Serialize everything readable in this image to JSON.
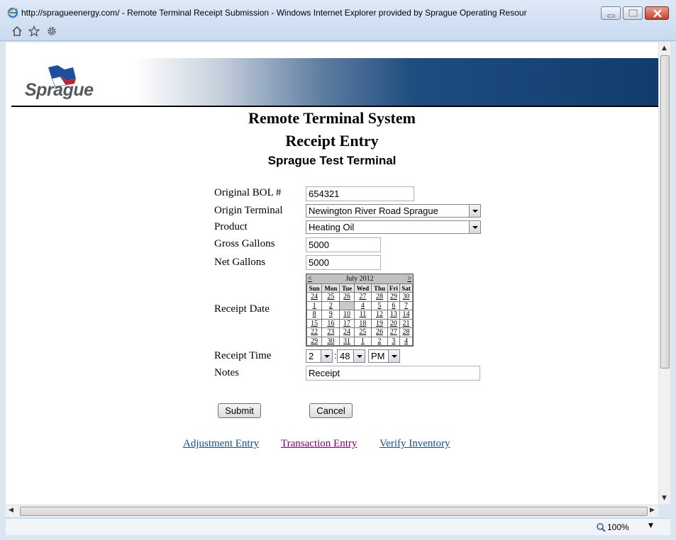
{
  "window": {
    "title": "http://spragueenergy.com/ - Remote Terminal Receipt Submission - Windows Internet Explorer provided by Sprague Operating Resour",
    "zoom": "100%"
  },
  "brand": {
    "logo_text": "Sprague",
    "banner_color": "#113c6e"
  },
  "header": {
    "title": "Remote Terminal System",
    "subtitle": "Receipt Entry",
    "terminal": "Sprague Test Terminal"
  },
  "form": {
    "bol_label": "Original BOL #",
    "bol_value": "654321",
    "origin_label": "Origin Terminal",
    "origin_value": "Newington River Road Sprague",
    "product_label": "Product",
    "product_value": "Heating Oil",
    "gross_label": "Gross Gallons",
    "gross_value": "5000",
    "net_label": "Net Gallons",
    "net_value": "5000",
    "date_label": "Receipt Date",
    "time_label": "Receipt Time",
    "time_hour": "2",
    "time_sep": ":",
    "time_minute": "48",
    "time_ampm": "PM",
    "notes_label": "Notes",
    "notes_value": "Receipt"
  },
  "calendar": {
    "month": "July 2012",
    "prev": "<",
    "next": ">",
    "days": [
      "Sun",
      "Mon",
      "Tue",
      "Wed",
      "Thu",
      "Fri",
      "Sat"
    ],
    "weeks": [
      [
        "24",
        "25",
        "26",
        "27",
        "28",
        "29",
        "30"
      ],
      [
        "1",
        "2",
        "3",
        "4",
        "5",
        "6",
        "7"
      ],
      [
        "8",
        "9",
        "10",
        "11",
        "12",
        "13",
        "14"
      ],
      [
        "15",
        "16",
        "17",
        "18",
        "19",
        "20",
        "21"
      ],
      [
        "22",
        "23",
        "24",
        "25",
        "26",
        "27",
        "28"
      ],
      [
        "29",
        "30",
        "31",
        "1",
        "2",
        "3",
        "4"
      ]
    ],
    "selected": "3"
  },
  "buttons": {
    "submit": "Submit",
    "cancel": "Cancel"
  },
  "links": {
    "adjustment": "Adjustment Entry",
    "transaction": "Transaction Entry",
    "verify": "Verify Inventory",
    "link_color": "#1a4c8c",
    "visited_color": "#800080"
  }
}
